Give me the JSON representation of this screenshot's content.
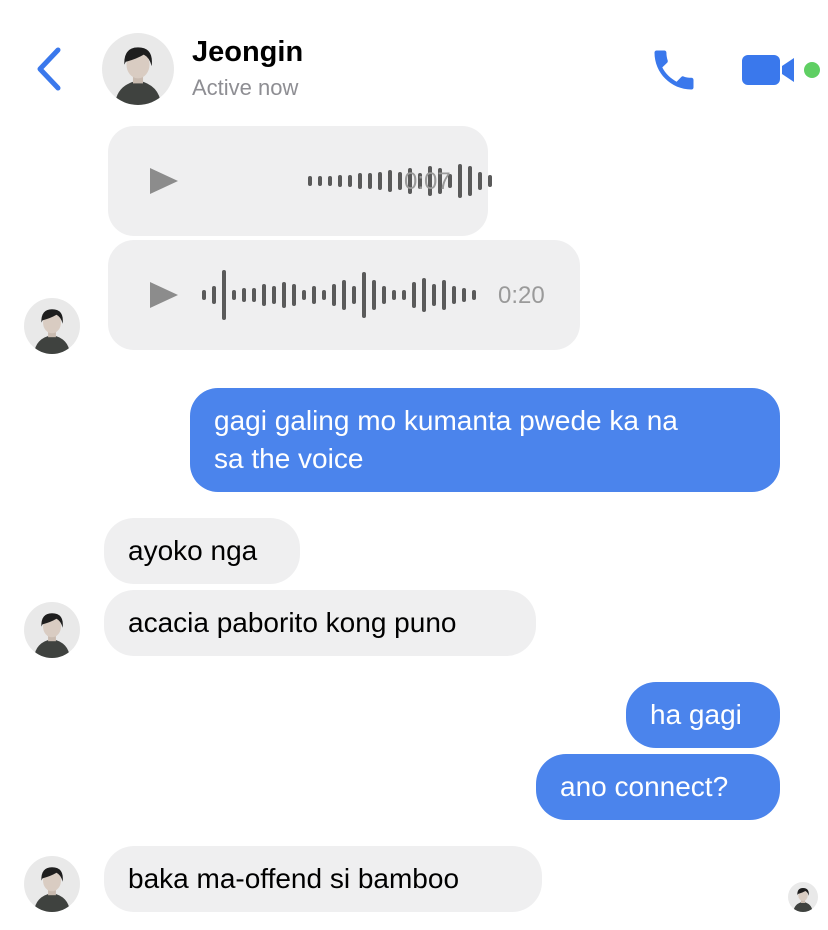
{
  "header": {
    "contact_name": "Jeongin",
    "status": "Active now",
    "back_icon": "chevron-left-icon",
    "call_icon": "phone-icon",
    "video_icon": "video-camera-icon",
    "accent_color": "#3a78ec",
    "online_color": "#5fcf63"
  },
  "messages": {
    "voice_1_duration": "0:07",
    "voice_2_duration": "0:20",
    "out_1_line1": "gagi galing mo kumanta pwede ka na",
    "out_1_line2": "sa the voice",
    "in_1": "ayoko nga",
    "in_2": "acacia paborito kong puno",
    "out_2": "ha gagi",
    "out_3": "ano connect?",
    "in_3": "baka ma-offend si bamboo"
  },
  "colors": {
    "incoming_bubble": "#efeff0",
    "outgoing_bubble": "#4b84ec"
  }
}
